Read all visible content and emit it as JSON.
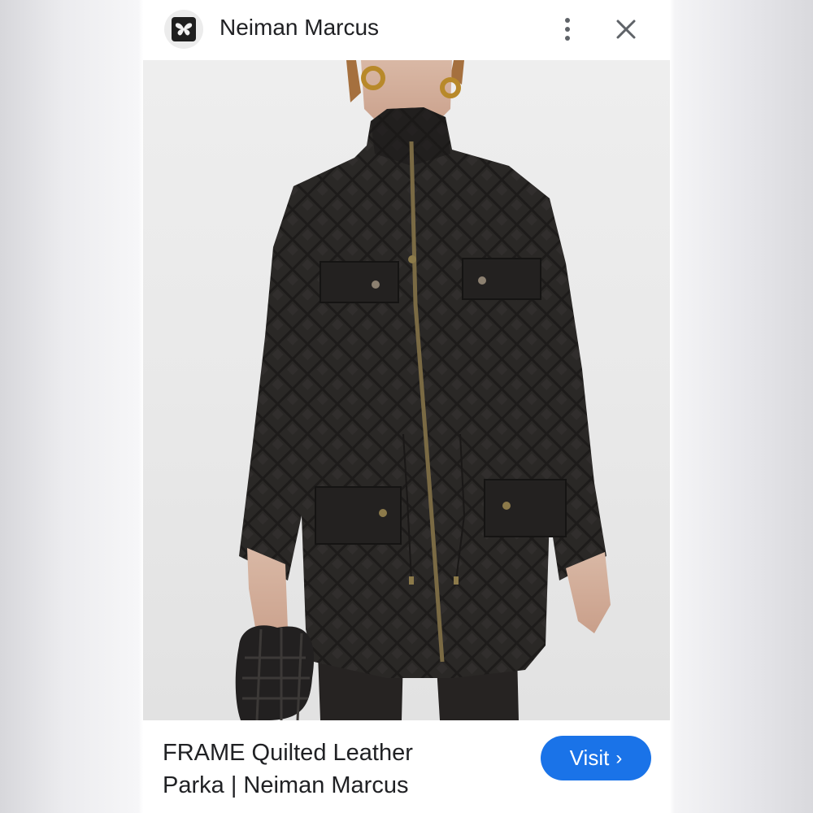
{
  "header": {
    "site_name": "Neiman Marcus",
    "logo_icon": "butterfly-logo-icon",
    "more_icon": "more-vert-icon",
    "close_icon": "close-icon"
  },
  "photo": {
    "subject": "quilted-leather-parka"
  },
  "caption": {
    "title_line1": "FRAME Quilted Leather",
    "title_line2": "Parka | Neiman Marcus",
    "visit_label": "Visit",
    "visit_chevron": "›"
  },
  "colors": {
    "accent": "#1a73e8",
    "text": "#202124",
    "icon": "#5f6368"
  }
}
